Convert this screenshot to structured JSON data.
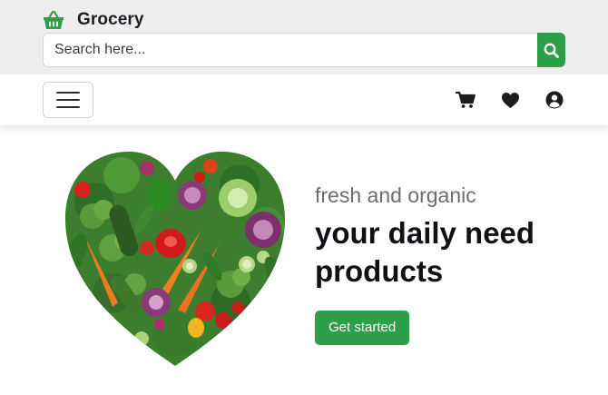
{
  "brand": {
    "name": "Grocery",
    "icon": "basket-icon",
    "color": "#2e9e48"
  },
  "search": {
    "placeholder": "Search here...",
    "icon": "search-icon"
  },
  "navbar": {
    "menu_icon": "hamburger-menu-icon",
    "icons": [
      "cart-icon",
      "heart-icon",
      "user-circle-icon"
    ]
  },
  "hero": {
    "image": "heart-shaped-vegetables-image",
    "tagline": "fresh and organic",
    "headline": "your daily need products",
    "cta_label": "Get started"
  },
  "colors": {
    "accent": "#2e9e48",
    "topbar_bg": "#eeeeee",
    "text_dark": "#0f1114",
    "text_muted": "#6a6e72"
  }
}
